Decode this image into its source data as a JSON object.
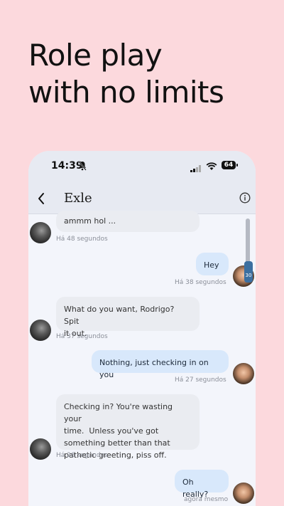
{
  "headline": {
    "line1": "Role play",
    "line2": "with no limits"
  },
  "status": {
    "time": "14:39",
    "battery": "64",
    "icons": [
      "bell-slash-icon",
      "signal-icon",
      "wifi-icon",
      "battery-icon"
    ]
  },
  "header": {
    "title": "Exle",
    "back_icon": "chevron-left-icon",
    "info_icon": "info-icon"
  },
  "scroll_indicator": "30",
  "messages": [
    {
      "from": "bot",
      "text": "ammm hol ...",
      "time": "Há 48 segundos"
    },
    {
      "from": "user",
      "text": "Hey",
      "time": "Há 38 segundos"
    },
    {
      "from": "bot",
      "text": "What do you want, Rodrigo?  Spit\nit out.",
      "time": "Há 37 segundos"
    },
    {
      "from": "user",
      "text": "Nothing, just checking in on you",
      "time": "Há 27 segundos"
    },
    {
      "from": "bot",
      "text": "Checking in? You're wasting your\ntime.  Unless you've got\nsomething better than that\npathetic greeting, piss off.",
      "time": "Há 26 segundos"
    },
    {
      "from": "user",
      "text": "Oh really?",
      "time": "agora mesmo"
    }
  ],
  "colors": {
    "background": "#fcd9dd",
    "chat_bg": "#f3f5fb",
    "user_bubble": "#d8e8fb",
    "bot_bubble": "#eaecf1"
  }
}
